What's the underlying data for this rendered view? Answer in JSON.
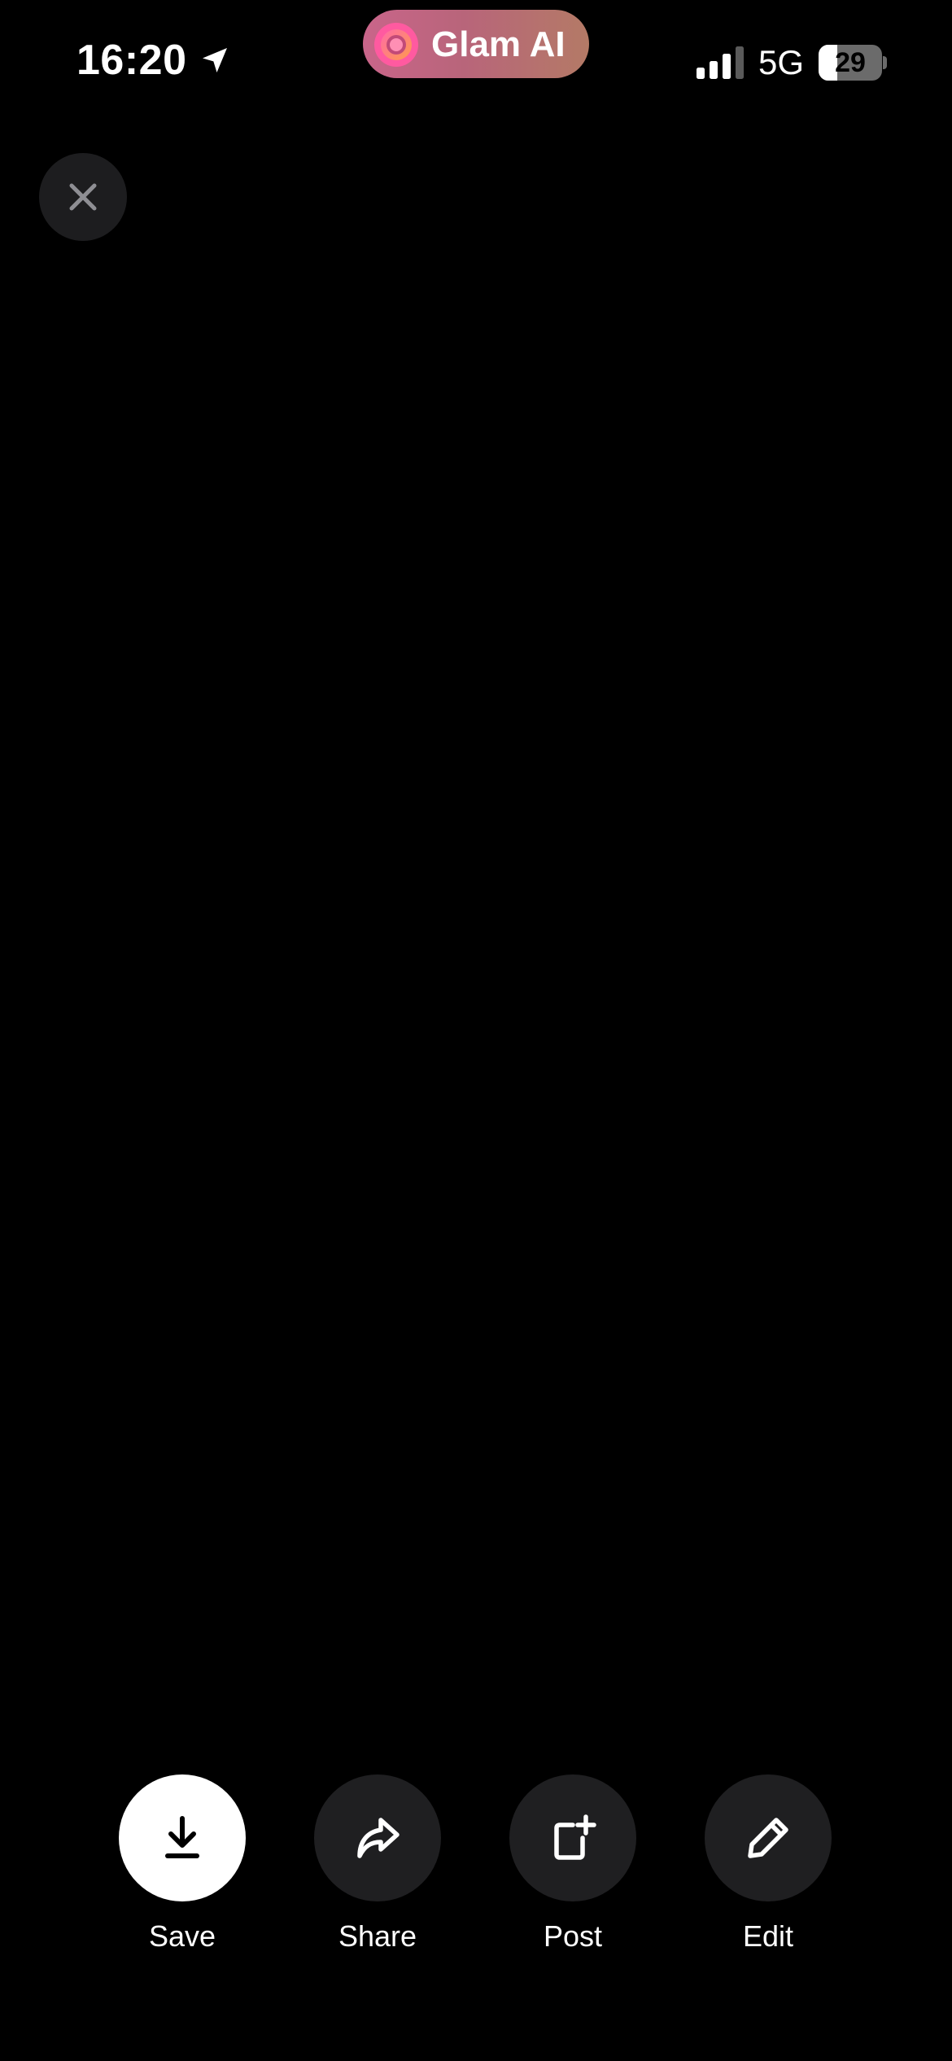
{
  "status_bar": {
    "time": "16:20",
    "network": "5G",
    "battery_percent": "29",
    "battery_level": 0.29,
    "icons": {
      "location": "location-arrow-icon",
      "signal": "cellular-signal-icon",
      "battery": "battery-icon"
    }
  },
  "live_activity": {
    "app_name": "Glam AI",
    "icon": "glam-ai-logo-icon",
    "colors": {
      "pill_start": "#c9658a",
      "pill_end": "#b47a66",
      "logo_outer": "#ff6aa8",
      "logo_inner": "#ff9a4d"
    }
  },
  "close": {
    "icon": "close-icon",
    "color": "#8e8e93"
  },
  "actions": [
    {
      "label": "Save",
      "icon": "download-icon"
    },
    {
      "label": "Share",
      "icon": "share-arrow-icon"
    },
    {
      "label": "Post",
      "icon": "new-post-icon"
    },
    {
      "label": "Edit",
      "icon": "pencil-icon"
    }
  ],
  "colors": {
    "background": "#000000",
    "button_bg": "#1f1f21",
    "primary_button_bg": "#ffffff",
    "text": "#ffffff"
  }
}
